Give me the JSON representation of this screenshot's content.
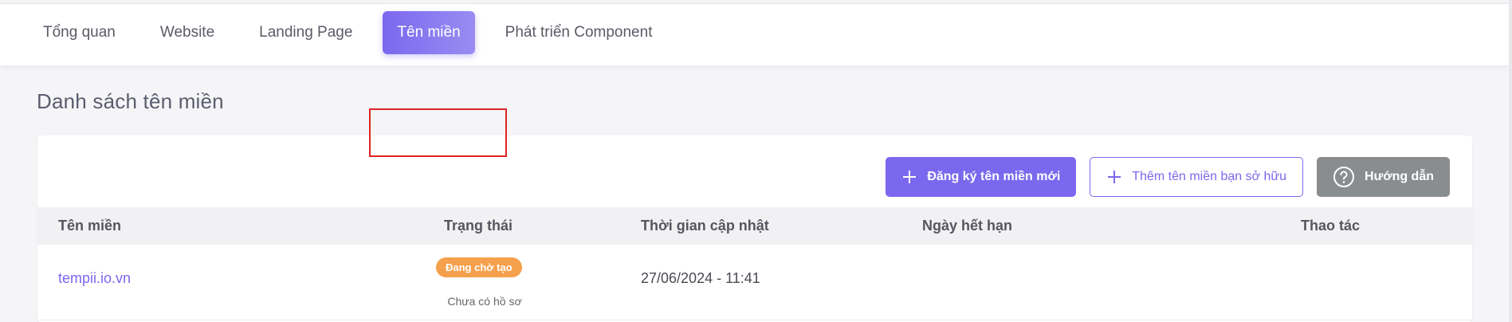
{
  "tabs": [
    {
      "label": "Tổng quan"
    },
    {
      "label": "Website"
    },
    {
      "label": "Landing Page"
    },
    {
      "label": "Tên miền"
    },
    {
      "label": "Phát triển Component"
    }
  ],
  "active_tab": "Tên miền",
  "page": {
    "title": "Danh sách tên miền"
  },
  "actions": {
    "register_label": "Đăng ký tên miền mới",
    "add_owned_label": "Thêm tên miền bạn sở hữu",
    "guide_label": "Hướng dẫn"
  },
  "table": {
    "columns": [
      "Tên miền",
      "Trạng thái",
      "Thời gian cập nhật",
      "Ngày hết hạn",
      "Thao tác"
    ],
    "rows": [
      {
        "domain": "tempii.io.vn",
        "status": "Đang chờ tạo",
        "status_note": "Chưa có hồ sơ",
        "updated": "27/06/2024 - 11:41",
        "expiry": "",
        "actions": ""
      }
    ]
  },
  "colors": {
    "accent": "#7b68ee",
    "badge_pending": "#f5a04c",
    "highlight_box": "#e02424",
    "grey_button": "#8a8d90"
  },
  "icons": {
    "register": "plus-icon",
    "add_owned": "plus-icon",
    "guide": "question-circle-icon"
  }
}
